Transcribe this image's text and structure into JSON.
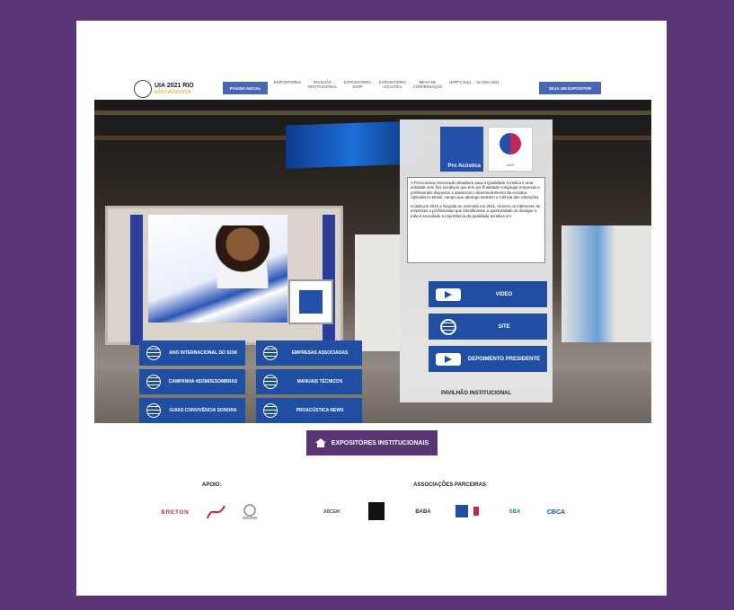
{
  "nav": {
    "logo_title": "UIA 2021 RIO",
    "logo_subtitle": "EXPO ACUSTICA",
    "main_button": "PÁGINA INICIAL",
    "links": [
      "EXPOSITORES",
      "PAVILHÃO INSTITUCIONAL",
      "EXPOSITORES SHOP",
      "EXPOSITORES ACÚSTICA",
      "MESA DE CONVERSAÇÃO",
      "HAPPY 2021",
      "ÚLTIMA 2021"
    ],
    "cta_button": "SEJA UM EXPOSITOR"
  },
  "panel": {
    "logo_text": "Pro Acústica",
    "logo2_text": "2020",
    "description_p1": "A ProAcústica Associação Brasileira para a Qualidade Acústica é uma entidade sem fins lucrativos que tem por finalidade congregar empresas e profissionais dispostos a alavancar o desenvolvimento da Acústica Aplicada no Brasil, campo que abrange também a Ciência das Vibrações.",
    "description_p2": "Criada em 2010 e lançada ao mercado em 2011, reúnem os interesses de empresas e profissionais que identificaram a oportunidade de divulgar a toda a sociedade a importância da qualidade acústica em",
    "buttons": [
      "VIDEO",
      "SITE",
      "DEPOIMENTO PRESIDENTE"
    ],
    "caption": "PAVILHÃO INSTITUCIONAL"
  },
  "booth_buttons": [
    "ANO INTERNACIONAL DO SOM",
    "EMPRESAS ASSOCIADAS",
    "CAMPANHA #SOMDESOMBRAS",
    "MANUAIS TÉCNICOS",
    "GUIAS CONVIVÊNCIA SONORA",
    "PROACÚSTICA NEWS"
  ],
  "main_cta": "EXPOSITORES INSTITUCIONAIS",
  "sections": {
    "apoio_title": "APOIO:",
    "associacoes_title": "ASSOCIAÇÕES PARCEIRAS:"
  },
  "apoio_logos": [
    "BRETON",
    "",
    ""
  ],
  "associacoes_logos": [
    "ABCEM",
    "",
    "BABA",
    "",
    "SBA",
    "CBCA"
  ],
  "colors": {
    "background": "#5b3476",
    "primary_blue": "#1f4ea3",
    "nav_blue": "#4965b7"
  }
}
